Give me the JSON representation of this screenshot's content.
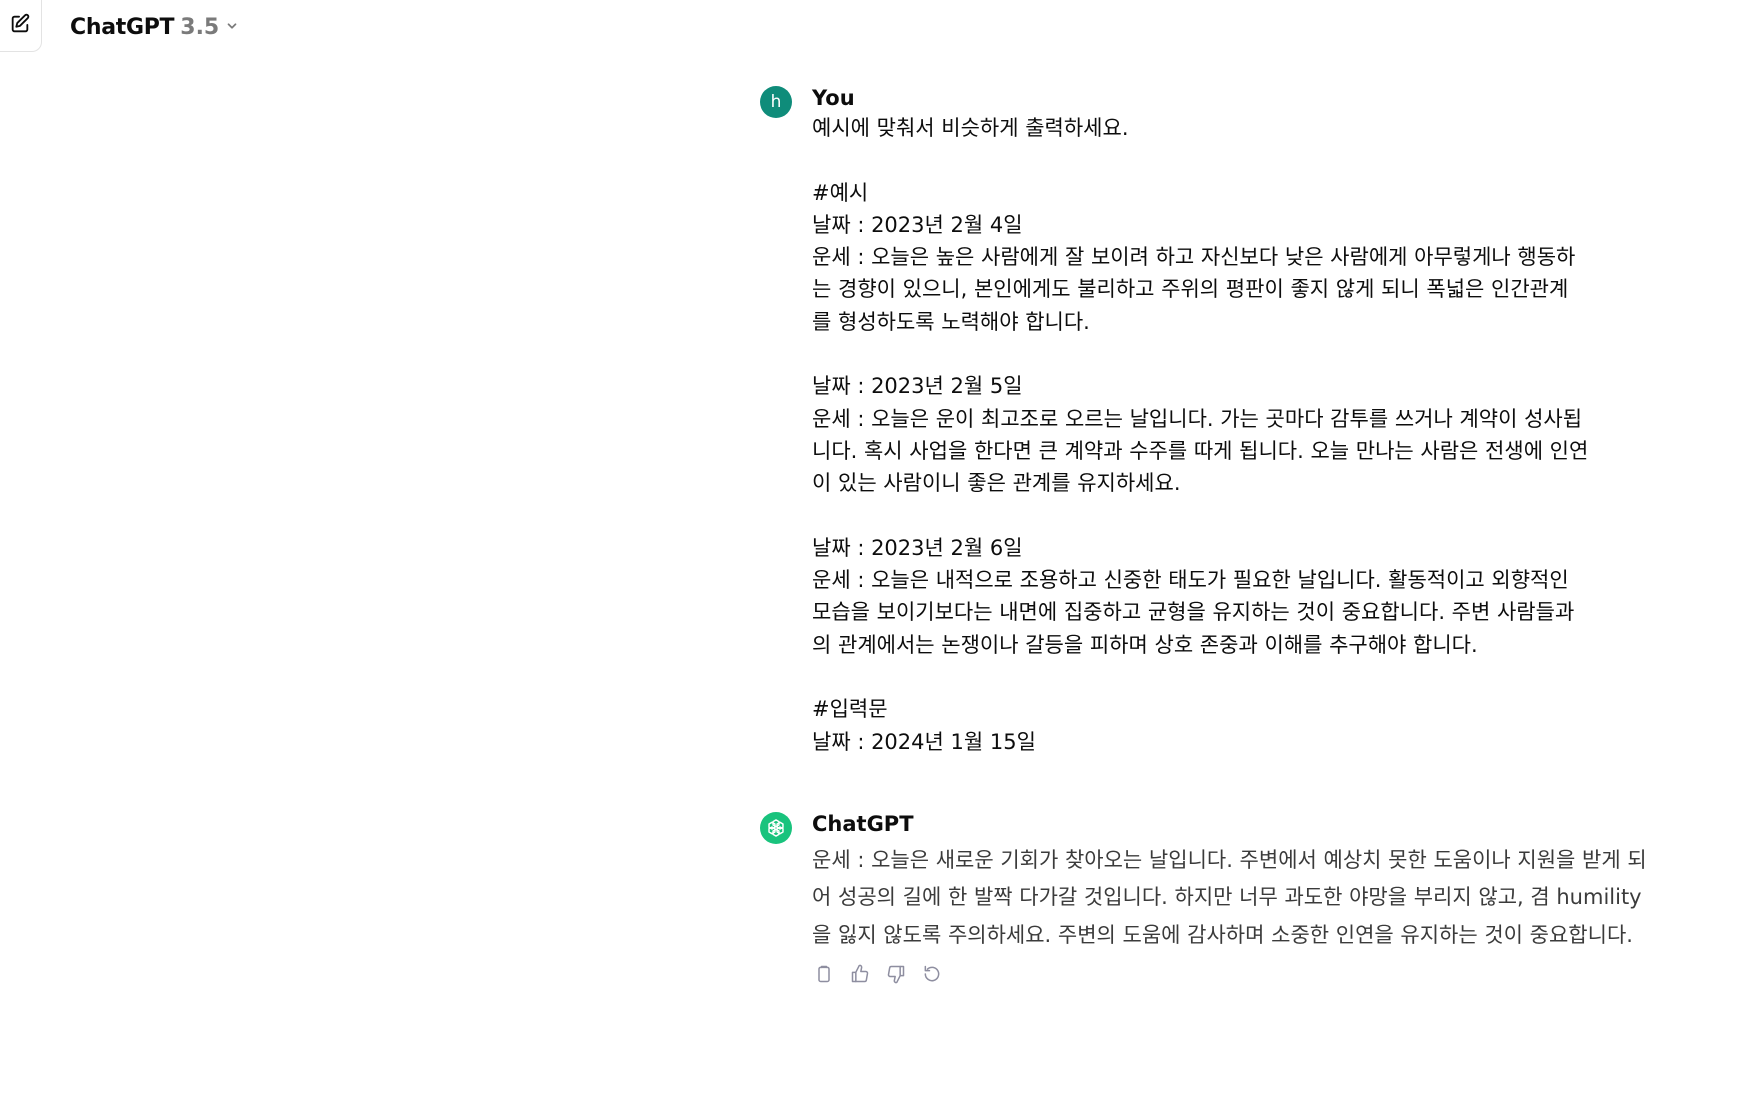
{
  "header": {
    "model_name": "ChatGPT",
    "model_version": "3.5",
    "new_chat_icon": "edit-icon",
    "chevron_icon": "chevron-down-icon"
  },
  "messages": {
    "user": {
      "author": "You",
      "avatar_letter": "h",
      "avatar_color": "#0f8c7a",
      "text": "예시에 맞춰서 비슷하게 출력하세요.\n\n#예시\n날짜 : 2023년 2월 4일\n운세 : 오늘은 높은 사람에게 잘 보이려 하고 자신보다 낮은 사람에게 아무렇게나 행동하\n는 경향이 있으니, 본인에게도 불리하고 주위의 평판이 좋지 않게 되니 폭넓은 인간관계\n를 형성하도록 노력해야 합니다.\n\n날짜 : 2023년 2월 5일\n운세 : 오늘은 운이 최고조로 오르는 날입니다. 가는 곳마다 감투를 쓰거나 계약이 성사됩\n니다. 혹시 사업을 한다면 큰 계약과 수주를 따게 됩니다. 오늘 만나는 사람은 전생에 인연\n이 있는 사람이니 좋은 관계를 유지하세요.\n\n날짜 : 2023년 2월 6일\n운세 : 오늘은 내적으로 조용하고 신중한 태도가 필요한 날입니다. 활동적이고 외향적인\n모습을 보이기보다는 내면에 집중하고 균형을 유지하는 것이 중요합니다. 주변 사람들과\n의 관계에서는 논쟁이나 갈등을 피하며 상호 존중과 이해를 추구해야 합니다.\n\n#입력문\n날짜 : 2024년 1월 15일"
    },
    "assistant": {
      "author": "ChatGPT",
      "avatar_icon": "openai-logo-icon",
      "avatar_color": "#19c37d",
      "text": "운세 : 오늘은 새로운 기회가 찾아오는 날입니다. 주변에서 예상치 못한 도움이나 지원을 받게 되어 성공의 길에 한 발짝 다가갈 것입니다. 하지만 너무 과도한 야망을 부리지 않고, 겸 humility을 잃지 않도록 주의하세요. 주변의 도움에 감사하며 소중한 인연을 유지하는 것이 중요합니다.",
      "actions": [
        "clipboard-icon",
        "thumbs-up-icon",
        "thumbs-down-icon",
        "regenerate-icon"
      ]
    }
  }
}
